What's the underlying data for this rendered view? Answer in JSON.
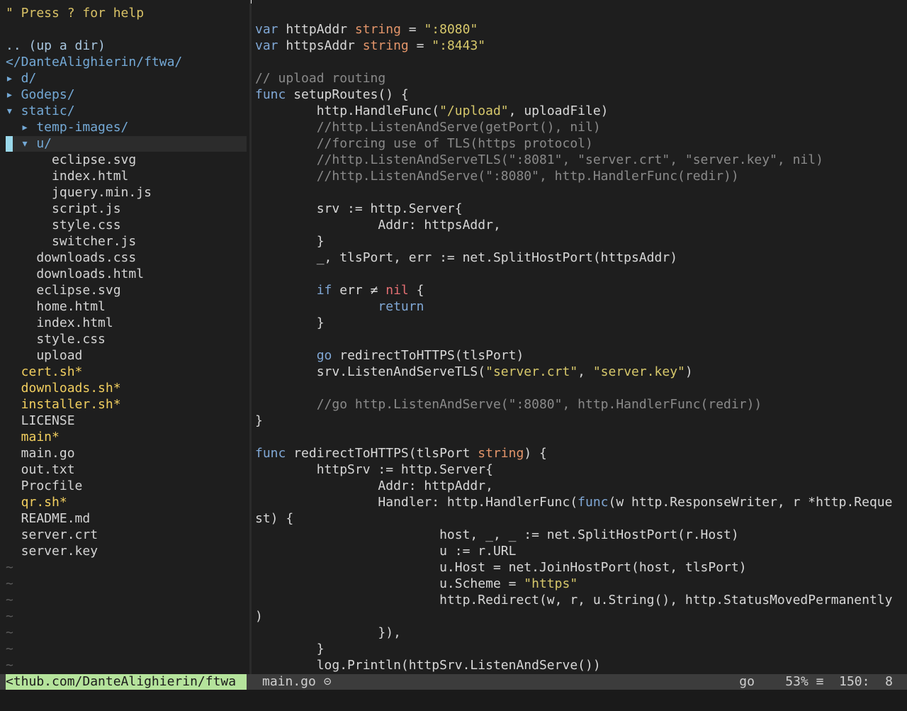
{
  "tree": {
    "help": "\" Press ? for help",
    "up_dir": ".. (up a dir)",
    "cwd": "</DanteAlighierin/ftwa/",
    "items": [
      {
        "text": "▸ d/",
        "kind": "dir"
      },
      {
        "text": "▸ Godeps/",
        "kind": "dir"
      },
      {
        "text": "▾ static/",
        "kind": "dir"
      },
      {
        "text": "  ▸ temp-images/",
        "kind": "dir"
      },
      {
        "text": "  ▾ u/",
        "kind": "dir"
      },
      {
        "text": "      eclipse.svg",
        "kind": "file"
      },
      {
        "text": "      index.html",
        "kind": "file"
      },
      {
        "text": "      jquery.min.js",
        "kind": "file"
      },
      {
        "text": "      script.js",
        "kind": "file"
      },
      {
        "text": "      style.css",
        "kind": "file"
      },
      {
        "text": "      switcher.js",
        "kind": "file"
      },
      {
        "text": "    downloads.css",
        "kind": "file"
      },
      {
        "text": "    downloads.html",
        "kind": "file"
      },
      {
        "text": "    eclipse.svg",
        "kind": "file"
      },
      {
        "text": "    home.html",
        "kind": "file"
      },
      {
        "text": "    index.html",
        "kind": "file"
      },
      {
        "text": "    style.css",
        "kind": "file"
      },
      {
        "text": "    upload",
        "kind": "file"
      },
      {
        "text": "  cert.sh*",
        "kind": "exec"
      },
      {
        "text": "  downloads.sh*",
        "kind": "exec"
      },
      {
        "text": "  installer.sh*",
        "kind": "exec"
      },
      {
        "text": "  LICENSE",
        "kind": "file"
      },
      {
        "text": "  main*",
        "kind": "exec"
      },
      {
        "text": "  main.go",
        "kind": "file"
      },
      {
        "text": "  out.txt",
        "kind": "file"
      },
      {
        "text": "  Procfile",
        "kind": "file"
      },
      {
        "text": "  qr.sh*",
        "kind": "exec"
      },
      {
        "text": "  README.md",
        "kind": "file"
      },
      {
        "text": "  server.crt",
        "kind": "file"
      },
      {
        "text": "  server.key",
        "kind": "file"
      }
    ],
    "tilde": "~",
    "tilde_count": 7
  },
  "code": {
    "lines": [
      [],
      [
        [
          "var",
          "kw"
        ],
        [
          " httpAddr ",
          "plain"
        ],
        [
          "string",
          "type"
        ],
        [
          " = ",
          "plain"
        ],
        [
          "\":8080\"",
          "str"
        ]
      ],
      [
        [
          "var",
          "kw"
        ],
        [
          " httpsAddr ",
          "plain"
        ],
        [
          "string",
          "type"
        ],
        [
          " = ",
          "plain"
        ],
        [
          "\":8443\"",
          "str"
        ]
      ],
      [],
      [
        [
          "// upload routing",
          "comment"
        ]
      ],
      [
        [
          "func",
          "kw"
        ],
        [
          " setupRoutes() {",
          "plain"
        ]
      ],
      [
        [
          "        http.HandleFunc(",
          "plain"
        ],
        [
          "\"/upload\"",
          "str"
        ],
        [
          ", uploadFile)",
          "plain"
        ]
      ],
      [
        [
          "        //http.ListenAndServe(getPort(), nil)",
          "comment"
        ]
      ],
      [
        [
          "        //forcing use of TLS(https protocol)",
          "comment"
        ]
      ],
      [
        [
          "        //http.ListenAndServeTLS(\":8081\", \"server.crt\", \"server.key\", nil)",
          "comment"
        ]
      ],
      [
        [
          "        //http.ListenAndServe(\":8080\", http.HandlerFunc(redir))",
          "comment"
        ]
      ],
      [],
      [
        [
          "        srv := http.Server{",
          "plain"
        ]
      ],
      [
        [
          "                Addr: httpsAddr,",
          "plain"
        ]
      ],
      [
        [
          "        }",
          "plain"
        ]
      ],
      [
        [
          "        _, tlsPort, err := net.SplitHostPort(httpsAddr)",
          "plain"
        ]
      ],
      [],
      [
        [
          "        ",
          "plain"
        ],
        [
          "if",
          "kw"
        ],
        [
          " err ≠ ",
          "plain"
        ],
        [
          "nil",
          "nil"
        ],
        [
          " {",
          "plain"
        ]
      ],
      [
        [
          "                ",
          "plain"
        ],
        [
          "return",
          "kw"
        ]
      ],
      [
        [
          "        }",
          "plain"
        ]
      ],
      [],
      [
        [
          "        ",
          "plain"
        ],
        [
          "go",
          "kw"
        ],
        [
          " redirectToHTTPS(tlsPort)",
          "plain"
        ]
      ],
      [
        [
          "        srv.ListenAndServeTLS(",
          "plain"
        ],
        [
          "\"server.crt\"",
          "str"
        ],
        [
          ", ",
          "plain"
        ],
        [
          "\"server.key\"",
          "str"
        ],
        [
          ")",
          "plain"
        ]
      ],
      [],
      [
        [
          "        //go http.ListenAndServe(\":8080\", http.HandlerFunc(redir))",
          "comment"
        ]
      ],
      [
        [
          "}",
          "plain"
        ]
      ],
      [],
      [
        [
          "func",
          "kw"
        ],
        [
          " redirectToHTTPS(tlsPort ",
          "plain"
        ],
        [
          "string",
          "type"
        ],
        [
          ") {",
          "plain"
        ]
      ],
      [
        [
          "        httpSrv := http.Server{",
          "plain"
        ]
      ],
      [
        [
          "                Addr: httpAddr,",
          "plain"
        ]
      ],
      [
        [
          "                Handler: http.HandlerFunc(",
          "plain"
        ],
        [
          "func",
          "kw"
        ],
        [
          "(w http.ResponseWriter, r *http.Reque",
          "plain"
        ]
      ],
      [
        [
          "st) {",
          "plain"
        ]
      ],
      [
        [
          "                        host, _, _ := net.SplitHostPort(r.Host)",
          "plain"
        ]
      ],
      [
        [
          "                        u := r.URL",
          "plain"
        ]
      ],
      [
        [
          "                        u.Host = net.JoinHostPort(host, tlsPort)",
          "plain"
        ]
      ],
      [
        [
          "                        u.Scheme = ",
          "plain"
        ],
        [
          "\"https\"",
          "str"
        ]
      ],
      [
        [
          "                        http.Redirect(w, r, u.String(), http.StatusMovedPermanently",
          "plain"
        ]
      ],
      [
        [
          ")",
          "plain"
        ]
      ],
      [
        [
          "                }),",
          "plain"
        ]
      ],
      [
        [
          "        }",
          "plain"
        ]
      ],
      [
        [
          "        log.Println(httpSrv.ListenAndServe())",
          "plain"
        ]
      ]
    ]
  },
  "status": {
    "path": "<thub.com/DanteAlighierin/ftwa",
    "file": "main.go ⊝",
    "right": "go    53% ≡  150:  8"
  },
  "colors": {
    "background": "#1e1e1e",
    "keyword": "#80a8d6",
    "type": "#e3956a",
    "string": "#d7c86b",
    "comment": "#8a8a8a",
    "nil": "#e46f73",
    "directory": "#74a9d6",
    "executable": "#f2cf5f",
    "status_path_bg": "#b5e39c"
  }
}
